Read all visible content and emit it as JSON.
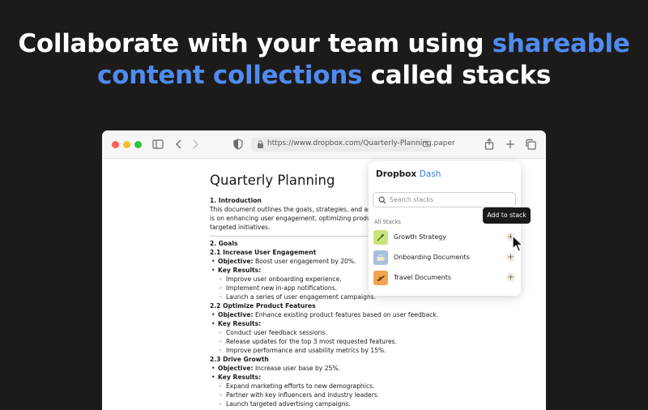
{
  "headline": {
    "line1_plain": "Collaborate with your team using ",
    "line1_highlight": "shareable",
    "line2_highlight": "content collections",
    "line2_plain": " called stacks"
  },
  "colors": {
    "highlight": "#4f8bf0",
    "background": "#1c1b1a"
  },
  "browser": {
    "url": "https://www.dropbox.com/Quarterly-Planning.paper"
  },
  "document": {
    "title": "Quarterly Planning",
    "intro_heading": "1. Introduction",
    "intro_lines": [
      "This document outlines the goals, strategies, and action plans",
      "is on enhancing user engagement, optimizing product feature",
      "targeted initiatives."
    ],
    "goals_heading": "2. Goals",
    "sections": [
      {
        "heading": "2.1 Increase User Engagement",
        "objective_label": "Objective:",
        "objective": " Boost user engagement by 20%.",
        "kr_label": "Key Results:",
        "results": [
          "Improve user onboarding experience.",
          "Implement new in-app notifications.",
          "Launch a series of user engagement campaigns."
        ]
      },
      {
        "heading": "2.2 Optimize Product Features",
        "objective_label": "Objective:",
        "objective": " Enhance existing product features based on user feedback.",
        "kr_label": "Key Results:",
        "results": [
          "Conduct user feedback sessions.",
          "Release updates for the top 3 most requested features.",
          "Improve performance and usability metrics by 15%."
        ]
      },
      {
        "heading": "2.3 Drive Growth",
        "objective_label": "Objective:",
        "objective": " Increase user base by 25%.",
        "kr_label": "Key Results:",
        "results": [
          "Expand marketing efforts to new demographics.",
          "Partner with key influencers and industry leaders.",
          "Launch targeted advertising campaigns."
        ]
      }
    ]
  },
  "dash": {
    "brand": "Dropbox",
    "brand_accent": "Dash",
    "search_placeholder": "Search stacks",
    "section_label": "All Stacks",
    "stacks": [
      {
        "name": "Growth Strategy",
        "icon": "sprout-icon",
        "color": "#c9e37a"
      },
      {
        "name": "Onboarding Documents",
        "icon": "coffee-cup-icon",
        "color": "#a9c0db"
      },
      {
        "name": "Travel Documents",
        "icon": "airplane-icon",
        "color": "#f0a64f"
      }
    ],
    "tooltip": "Add to stack"
  }
}
